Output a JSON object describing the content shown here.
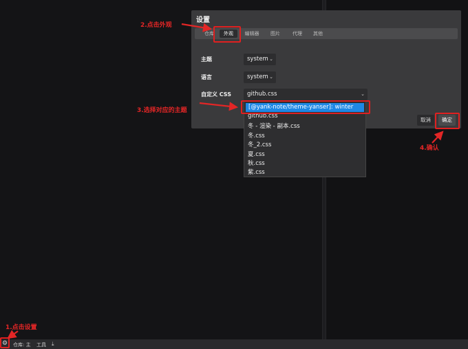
{
  "dialog": {
    "title": "设置",
    "tabs": [
      {
        "label": "仓库"
      },
      {
        "label": "外观"
      },
      {
        "label": "编辑器"
      },
      {
        "label": "图片"
      },
      {
        "label": "代理"
      },
      {
        "label": "其他"
      }
    ],
    "active_tab": "外观",
    "theme": {
      "label": "主题",
      "value": "system"
    },
    "language": {
      "label": "语言",
      "value": "system"
    },
    "custom_css": {
      "label": "自定义 CSS",
      "value": "github.css"
    },
    "cancel_label": "取消",
    "ok_label": "确定"
  },
  "css_dropdown": {
    "options": [
      "[@yank-note/theme-yanser]: winter",
      "github.css",
      "冬 - 渲染 - 副本.css",
      "冬.css",
      "冬_2.css",
      "夏.css",
      "秋.css",
      "紫.css"
    ],
    "highlighted": "[@yank-note/theme-yanser]: winter"
  },
  "statusbar": {
    "repo": "仓库: 主",
    "tools": "工具",
    "settings_icon": "gear-icon",
    "download_icon": "download-icon"
  },
  "annotations": {
    "step1": "1.点击设置",
    "step2": "2.点击外观",
    "step3": "3.选择对应的主题",
    "step4": "4.确认"
  },
  "colors": {
    "annotation": "#e32626",
    "highlight": "#1e88e5",
    "dialog_bg": "#3a3a3c"
  }
}
